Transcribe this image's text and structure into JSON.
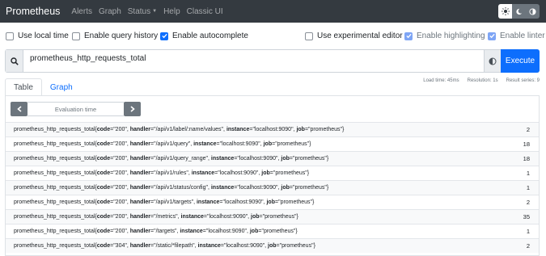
{
  "nav": {
    "brand": "Prometheus",
    "links": [
      {
        "label": "Alerts"
      },
      {
        "label": "Graph"
      },
      {
        "label": "Status"
      },
      {
        "label": "Help"
      },
      {
        "label": "Classic UI"
      }
    ],
    "theme": {
      "options": [
        "sun-icon",
        "moon-icon",
        "half-circle-icon"
      ],
      "active": "moon-icon"
    }
  },
  "options": {
    "local_time": {
      "label": "Use local time",
      "checked": false
    },
    "query_history": {
      "label": "Enable query history",
      "checked": false
    },
    "autocomplete": {
      "label": "Enable autocomplete",
      "checked": true
    },
    "experimental_editor": {
      "label": "Use experimental editor",
      "checked": false
    },
    "highlighting": {
      "label": "Enable highlighting",
      "checked": true
    },
    "linter": {
      "label": "Enable linter",
      "checked": true
    }
  },
  "expression": {
    "value": "prometheus_http_requests_total",
    "execute_label": "Execute",
    "icons": {
      "search": "search-icon",
      "explorer": "globe-icon"
    }
  },
  "stats": {
    "load_time": "Load time: 45ms",
    "resolution": "Resolution: 1s",
    "result_series": "Result series: 9"
  },
  "tabs": [
    {
      "label": "Table",
      "active": true
    },
    {
      "label": "Graph",
      "active": false
    }
  ],
  "evaluation": {
    "placeholder": "Evaluation time"
  },
  "results": [
    {
      "metric": "prometheus_http_requests_total",
      "labels": [
        {
          "k": "code",
          "v": "\"200\""
        },
        {
          "k": "handler",
          "v": "\"/api/v1/label/:name/values\""
        },
        {
          "k": "instance",
          "v": "\"localhost:9090\""
        },
        {
          "k": "job",
          "v": "\"prometheus\""
        }
      ],
      "value": "2"
    },
    {
      "metric": "prometheus_http_requests_total",
      "labels": [
        {
          "k": "code",
          "v": "\"200\""
        },
        {
          "k": "handler",
          "v": "\"/api/v1/query\""
        },
        {
          "k": "instance",
          "v": "\"localhost:9090\""
        },
        {
          "k": "job",
          "v": "\"prometheus\""
        }
      ],
      "value": "18"
    },
    {
      "metric": "prometheus_http_requests_total",
      "labels": [
        {
          "k": "code",
          "v": "\"200\""
        },
        {
          "k": "handler",
          "v": "\"/api/v1/query_range\""
        },
        {
          "k": "instance",
          "v": "\"localhost:9090\""
        },
        {
          "k": "job",
          "v": "\"prometheus\""
        }
      ],
      "value": "18"
    },
    {
      "metric": "prometheus_http_requests_total",
      "labels": [
        {
          "k": "code",
          "v": "\"200\""
        },
        {
          "k": "handler",
          "v": "\"/api/v1/rules\""
        },
        {
          "k": "instance",
          "v": "\"localhost:9090\""
        },
        {
          "k": "job",
          "v": "\"prometheus\""
        }
      ],
      "value": "1"
    },
    {
      "metric": "prometheus_http_requests_total",
      "labels": [
        {
          "k": "code",
          "v": "\"200\""
        },
        {
          "k": "handler",
          "v": "\"/api/v1/status/config\""
        },
        {
          "k": "instance",
          "v": "\"localhost:9090\""
        },
        {
          "k": "job",
          "v": "\"prometheus\""
        }
      ],
      "value": "1"
    },
    {
      "metric": "prometheus_http_requests_total",
      "labels": [
        {
          "k": "code",
          "v": "\"200\""
        },
        {
          "k": "handler",
          "v": "\"/api/v1/targets\""
        },
        {
          "k": "instance",
          "v": "\"localhost:9090\""
        },
        {
          "k": "job",
          "v": "\"prometheus\""
        }
      ],
      "value": "2"
    },
    {
      "metric": "prometheus_http_requests_total",
      "labels": [
        {
          "k": "code",
          "v": "\"200\""
        },
        {
          "k": "handler",
          "v": "\"/metrics\""
        },
        {
          "k": "instance",
          "v": "\"localhost:9090\""
        },
        {
          "k": "job",
          "v": "\"prometheus\""
        }
      ],
      "value": "35"
    },
    {
      "metric": "prometheus_http_requests_total",
      "labels": [
        {
          "k": "code",
          "v": "\"200\""
        },
        {
          "k": "handler",
          "v": "\"/targets\""
        },
        {
          "k": "instance",
          "v": "\"localhost:9090\""
        },
        {
          "k": "job",
          "v": "\"prometheus\""
        }
      ],
      "value": "1"
    },
    {
      "metric": "prometheus_http_requests_total",
      "labels": [
        {
          "k": "code",
          "v": "\"304\""
        },
        {
          "k": "handler",
          "v": "\"/static/*filepath\""
        },
        {
          "k": "instance",
          "v": "\"localhost:9090\""
        },
        {
          "k": "job",
          "v": "\"prometheus\""
        }
      ],
      "value": "2"
    }
  ],
  "colors": {
    "navbar": "#343a40",
    "primary": "#0d6efd",
    "muted": "#6c757d"
  }
}
